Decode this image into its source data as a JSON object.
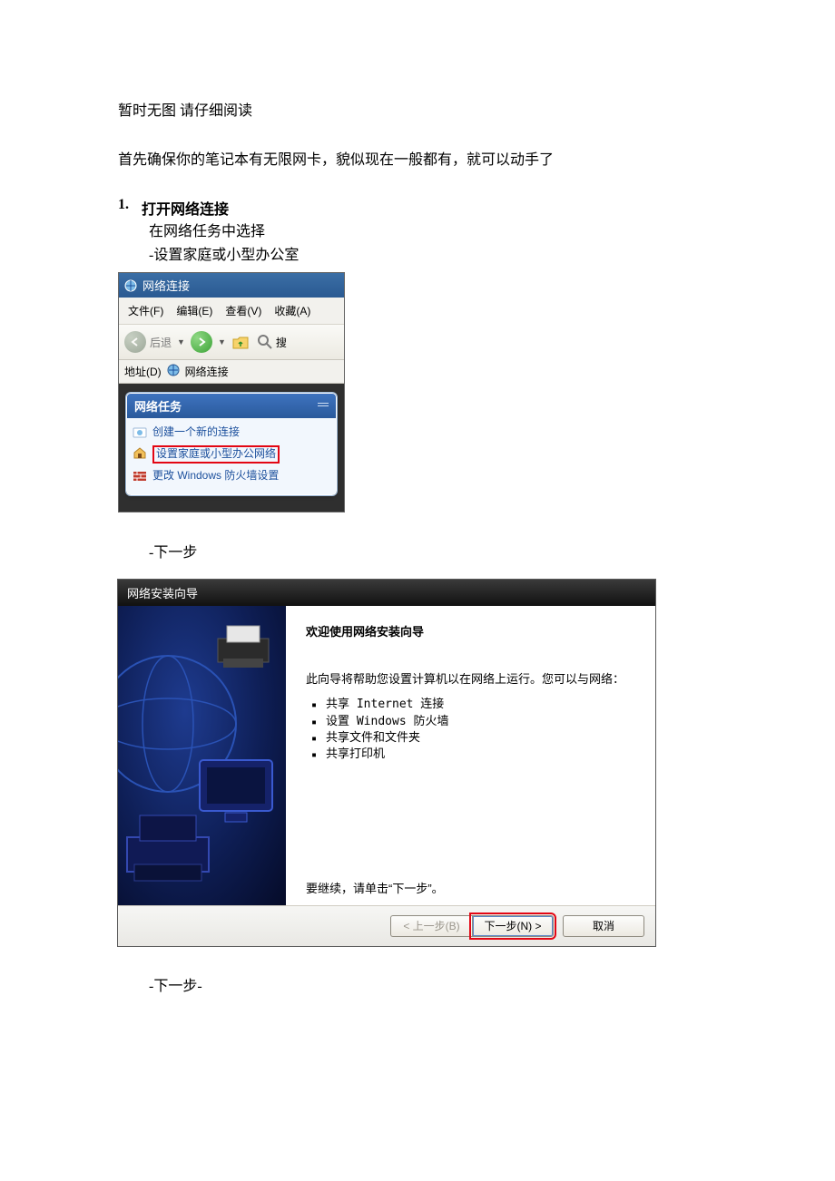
{
  "doc": {
    "title_line": "暂时无图  请仔细阅读",
    "intro": "首先确保你的笔记本有无限网卡，貌似现在一般都有，就可以动手了",
    "step1_num": "1.",
    "step1_title": "打开网络连接",
    "step1_sub1": "在网络任务中选择",
    "step1_sub2": "-设置家庭或小型办公室",
    "next1": "-下一步",
    "next2": "-下一步-"
  },
  "nc": {
    "title": "网络连接",
    "menu": {
      "file": "文件(F)",
      "edit": "编辑(E)",
      "view": "查看(V)",
      "fav": "收藏(A)"
    },
    "toolbar": {
      "back": "后退",
      "search": "搜"
    },
    "addr_label": "地址(D)",
    "addr_value": "网络连接",
    "task_header": "网络任务",
    "items": [
      {
        "label": "创建一个新的连接"
      },
      {
        "label": "设置家庭或小型办公网络"
      },
      {
        "label": "更改 Windows 防火墙设置"
      }
    ]
  },
  "wiz": {
    "title": "网络安装向导",
    "heading": "欢迎使用网络安装向导",
    "desc": "此向导将帮助您设置计算机以在网络上运行。您可以与网络：",
    "list": [
      "共享 Internet 连接",
      "设置 Windows 防火墙",
      "共享文件和文件夹",
      "共享打印机"
    ],
    "continue": "要继续，请单击“下一步”。",
    "buttons": {
      "back": "< 上一步(B)",
      "next": "下一步(N) >",
      "cancel": "取消"
    }
  }
}
